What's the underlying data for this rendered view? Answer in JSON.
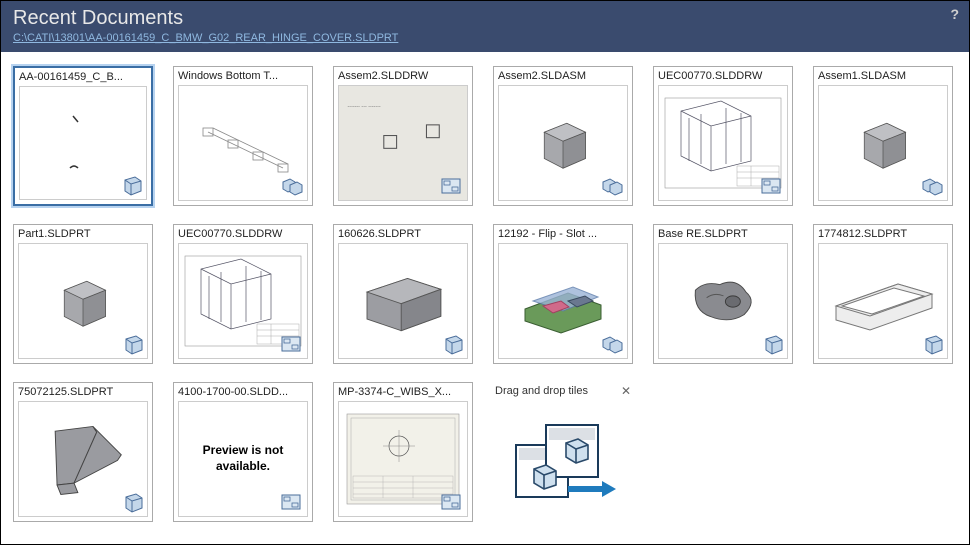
{
  "header": {
    "title": "Recent Documents",
    "path": "C:\\CATI\\13801\\AA-00161459_C_BMW_G02_REAR_HINGE_COVER.SLDPRT"
  },
  "tiles": [
    {
      "label": "AA-00161459_C_B...",
      "type": "part",
      "preview": "sparse",
      "selected": true
    },
    {
      "label": "Windows Bottom T...",
      "type": "asm",
      "preview": "wireframe",
      "selected": false
    },
    {
      "label": "Assem2.SLDDRW",
      "type": "drw",
      "preview": "drawing-rects",
      "selected": false
    },
    {
      "label": "Assem2.SLDASM",
      "type": "asm",
      "preview": "cube",
      "selected": false
    },
    {
      "label": "UEC00770.SLDDRW",
      "type": "drw",
      "preview": "rack-drawing",
      "selected": false
    },
    {
      "label": "Assem1.SLDASM",
      "type": "asm",
      "preview": "cube",
      "selected": false
    },
    {
      "label": "Part1.SLDPRT",
      "type": "part",
      "preview": "cube",
      "selected": false
    },
    {
      "label": "UEC00770.SLDDRW",
      "type": "drw",
      "preview": "rack-drawing",
      "selected": false
    },
    {
      "label": "160626.SLDPRT",
      "type": "part",
      "preview": "cube-long",
      "selected": false
    },
    {
      "label": "12192 - Flip - Slot ...",
      "type": "asm",
      "preview": "complex-asm",
      "selected": false
    },
    {
      "label": "Base RE.SLDPRT",
      "type": "part",
      "preview": "base-part",
      "selected": false
    },
    {
      "label": "1774812.SLDPRT",
      "type": "part",
      "preview": "tray",
      "selected": false
    },
    {
      "label": "75072125.SLDPRT",
      "type": "part",
      "preview": "bracket",
      "selected": false
    },
    {
      "label": "4100-1700-00.SLDD...",
      "type": "drw",
      "preview": "none",
      "selected": false
    },
    {
      "label": "MP-3374-C_WIBS_X...",
      "type": "drw",
      "preview": "sheet-drawing",
      "selected": false
    }
  ],
  "dnd": {
    "label": "Drag and drop tiles"
  },
  "previewNotAvailable": "Preview is not available."
}
